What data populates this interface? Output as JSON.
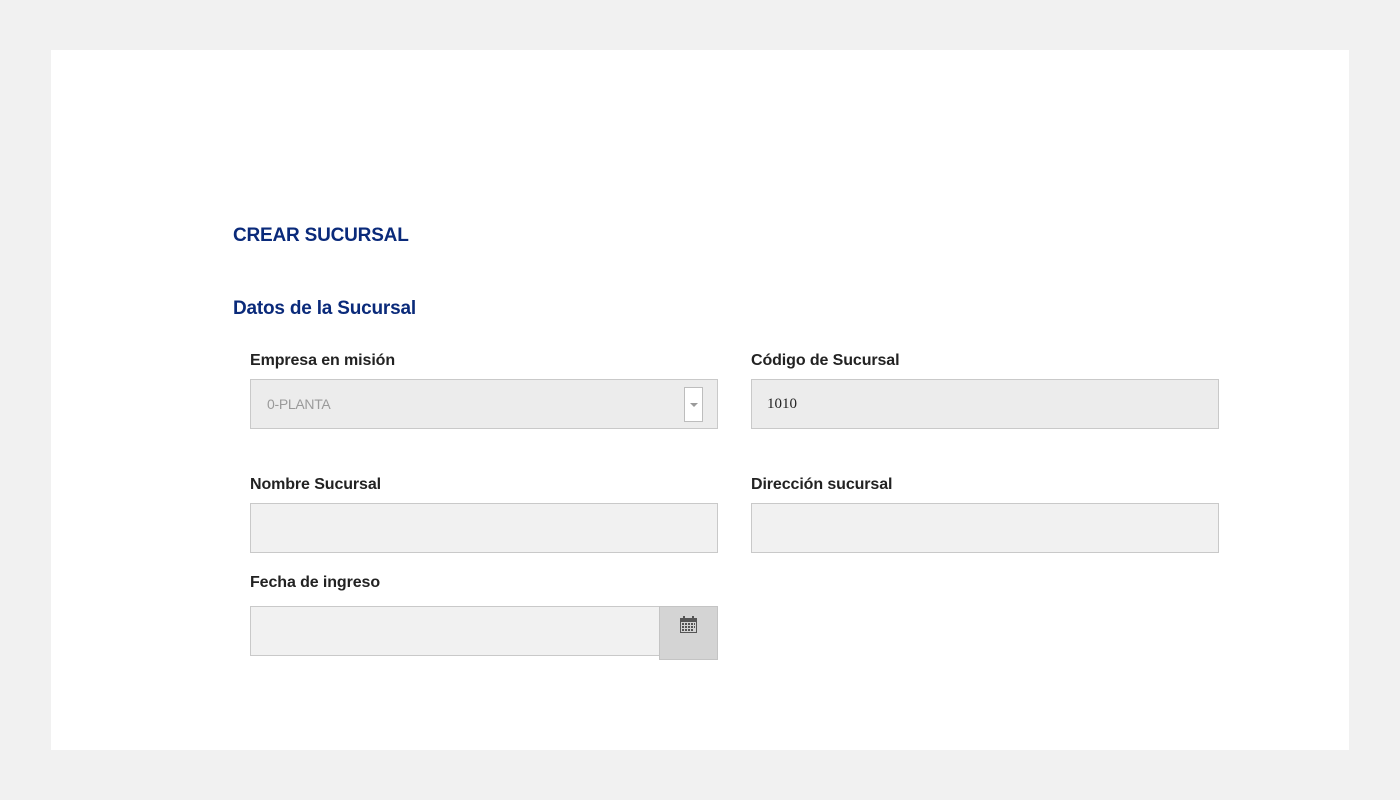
{
  "page": {
    "title": "CREAR SUCURSAL",
    "section_title": "Datos de la Sucursal"
  },
  "form": {
    "empresa": {
      "label": "Empresa en misión",
      "value": "0-PLANTA"
    },
    "codigo": {
      "label": "Código de Sucursal",
      "value": "1010"
    },
    "nombre": {
      "label": "Nombre Sucursal",
      "value": ""
    },
    "direccion": {
      "label": "Dirección sucursal",
      "value": ""
    },
    "fecha": {
      "label": "Fecha de ingreso",
      "value": "",
      "icon": "calendar-icon"
    }
  },
  "colors": {
    "background": "#f1f1f1",
    "card": "#ffffff",
    "heading": "#0a2a7a",
    "label": "#222222",
    "field_bg": "#f1f1f1",
    "field_border": "#c9c9c9",
    "date_button": "#d4d4d4"
  }
}
